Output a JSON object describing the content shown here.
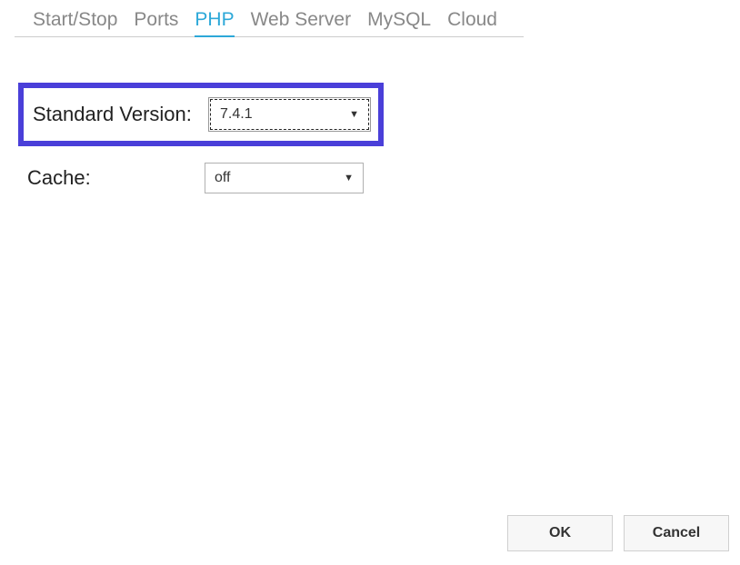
{
  "tabs": {
    "startstop": "Start/Stop",
    "ports": "Ports",
    "php": "PHP",
    "webserver": "Web Server",
    "mysql": "MySQL",
    "cloud": "Cloud"
  },
  "form": {
    "standard_version_label": "Standard Version:",
    "standard_version_value": "7.4.1",
    "cache_label": "Cache:",
    "cache_value": "off"
  },
  "buttons": {
    "ok": "OK",
    "cancel": "Cancel"
  }
}
